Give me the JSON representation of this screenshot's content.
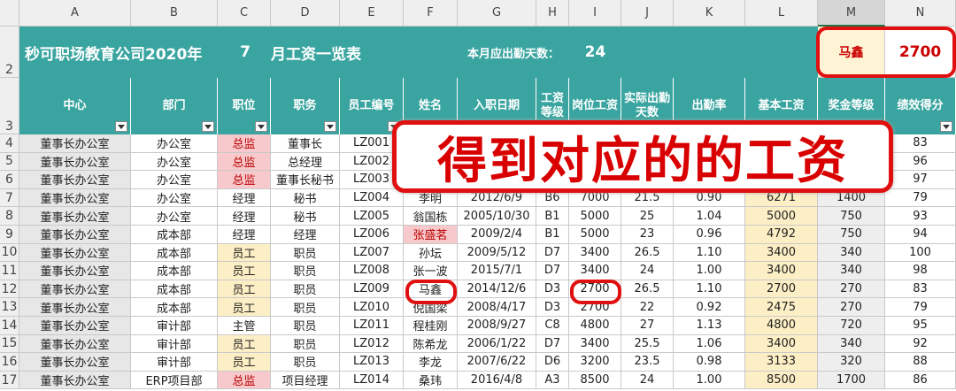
{
  "column_letters": [
    "A",
    "B",
    "C",
    "D",
    "E",
    "F",
    "G",
    "H",
    "I",
    "J",
    "K",
    "L",
    "M",
    "N"
  ],
  "title": {
    "company": "秒可职场教育公司2020年",
    "month": "7",
    "suffix": "月工资一览表",
    "days_label": "本月应出勤天数：",
    "days_value": "24",
    "lookup_name": "马鑫",
    "lookup_value": "2700"
  },
  "headers": [
    "中心",
    "部门",
    "职位",
    "职务",
    "员工编号",
    "姓名",
    "入职日期",
    "工资等级",
    "岗位工资",
    "实际出勤天数",
    "出勤率",
    "基本工资",
    "奖金等级",
    "绩效得分"
  ],
  "overlay_text": "得到对应的的工资",
  "rows": [
    {
      "r": "4",
      "c": [
        "董事长办公室",
        "办公室",
        "总监",
        "董事长",
        "LZ001",
        "",
        "",
        "",
        "",
        "",
        "",
        "",
        "",
        "83"
      ]
    },
    {
      "r": "5",
      "c": [
        "董事长办公室",
        "办公室",
        "总监",
        "总经理",
        "LZ002",
        "",
        "",
        "",
        "",
        "",
        "",
        "",
        "",
        "96"
      ]
    },
    {
      "r": "6",
      "c": [
        "董事长办公室",
        "办公室",
        "总监",
        "董事长秘书",
        "LZ003",
        "",
        "",
        "",
        "",
        "",
        "",
        "",
        "",
        "97"
      ]
    },
    {
      "r": "7",
      "c": [
        "董事长办公室",
        "办公室",
        "经理",
        "秘书",
        "LZ004",
        "李明",
        "2012/6/9",
        "B6",
        "7000",
        "21.5",
        "0.90",
        "6271",
        "1400",
        "79"
      ]
    },
    {
      "r": "8",
      "c": [
        "董事长办公室",
        "办公室",
        "经理",
        "秘书",
        "LZ005",
        "翁国栋",
        "2005/10/30",
        "B1",
        "5000",
        "25",
        "1.04",
        "5000",
        "750",
        "93"
      ]
    },
    {
      "r": "9",
      "c": [
        "董事长办公室",
        "成本部",
        "经理",
        "经理",
        "LZ006",
        "张盛茗",
        "2009/2/4",
        "B1",
        "5000",
        "23",
        "0.96",
        "4792",
        "750",
        "94"
      ]
    },
    {
      "r": "10",
      "c": [
        "董事长办公室",
        "成本部",
        "员工",
        "职员",
        "LZ007",
        "孙坛",
        "2009/5/12",
        "D7",
        "3400",
        "26.5",
        "1.10",
        "3400",
        "340",
        "100"
      ]
    },
    {
      "r": "11",
      "c": [
        "董事长办公室",
        "成本部",
        "员工",
        "职员",
        "LZ008",
        "张一波",
        "2015/7/1",
        "D7",
        "3400",
        "24",
        "1.00",
        "3400",
        "340",
        "98"
      ]
    },
    {
      "r": "12",
      "c": [
        "董事长办公室",
        "成本部",
        "员工",
        "职员",
        "LZ009",
        "马鑫",
        "2014/12/6",
        "D3",
        "2700",
        "26.5",
        "1.10",
        "2700",
        "270",
        "83"
      ]
    },
    {
      "r": "13",
      "c": [
        "董事长办公室",
        "成本部",
        "员工",
        "职员",
        "LZ010",
        "倪国梁",
        "2008/4/17",
        "D3",
        "2700",
        "22",
        "0.92",
        "2475",
        "270",
        "79"
      ]
    },
    {
      "r": "14",
      "c": [
        "董事长办公室",
        "审计部",
        "主管",
        "职员",
        "LZ011",
        "程桂刚",
        "2008/9/27",
        "C8",
        "4800",
        "27",
        "1.13",
        "4800",
        "720",
        "95"
      ]
    },
    {
      "r": "15",
      "c": [
        "董事长办公室",
        "审计部",
        "员工",
        "职员",
        "LZ012",
        "陈希龙",
        "2006/1/22",
        "D7",
        "3400",
        "25.5",
        "1.06",
        "3400",
        "340",
        "92"
      ]
    },
    {
      "r": "16",
      "c": [
        "董事长办公室",
        "审计部",
        "员工",
        "职员",
        "LZ013",
        "李龙",
        "2007/6/22",
        "D6",
        "3200",
        "23.5",
        "0.98",
        "3133",
        "320",
        "88"
      ]
    },
    {
      "r": "17",
      "c": [
        "董事长办公室",
        "ERP项目部",
        "总监",
        "项目经理",
        "LZ014",
        "桑玮",
        "2016/4/8",
        "A3",
        "8500",
        "24",
        "1.00",
        "8500",
        "1700",
        "86"
      ]
    }
  ]
}
